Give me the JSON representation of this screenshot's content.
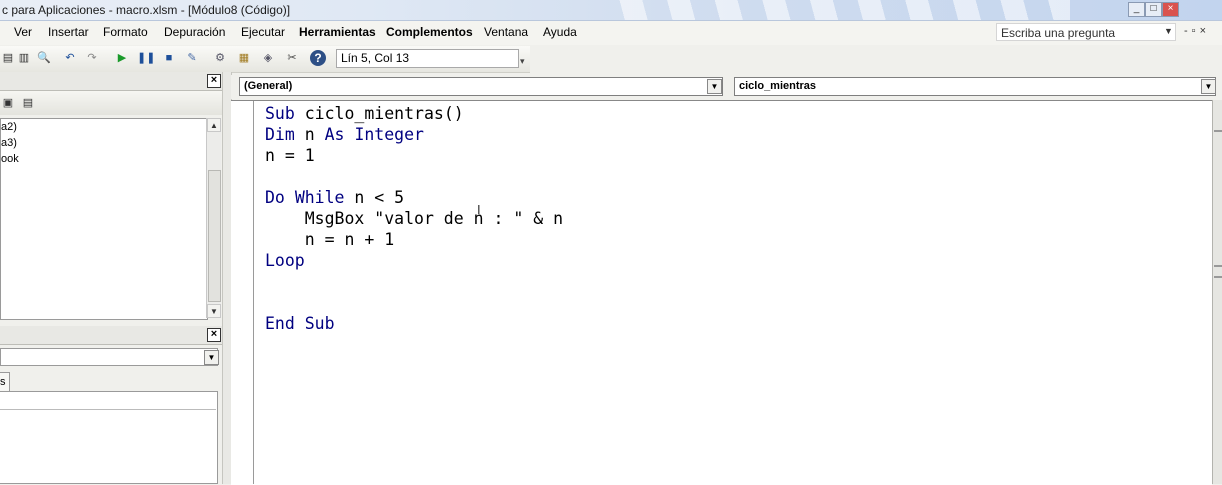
{
  "window": {
    "title": "c para Aplicaciones - macro.xlsm - [Módulo8 (Código)]",
    "controls": [
      "_",
      "□",
      "×"
    ]
  },
  "menu": {
    "items": [
      "Ver",
      "Insertar",
      "Formato",
      "Depuración",
      "Ejecutar",
      "Herramientas",
      "Complementos",
      "Ventana",
      "Ayuda"
    ],
    "ask_placeholder": "Escriba una pregunta"
  },
  "toolbar": {
    "position_text": "Lín 5, Col 13",
    "icons": [
      "excel-icon",
      "insert-module-icon",
      "cut-icon",
      "copy-icon",
      "paste-icon",
      "find-icon",
      "undo-icon",
      "redo-icon",
      "run-icon",
      "break-icon",
      "reset-icon",
      "design-mode-icon",
      "project-explorer-icon",
      "properties-icon",
      "object-browser-icon",
      "toolbox-icon",
      "help-icon"
    ]
  },
  "project_panel": {
    "tree_items": [
      "a2)",
      "a3)",
      "ook"
    ]
  },
  "code_window": {
    "object_combo": "(General)",
    "procedure_combo": "ciclo_mientras",
    "lines": [
      "Sub ciclo_mientras()",
      "Dim n As Integer",
      "n = 1",
      "",
      "Do While n < 5",
      "    MsgBox \"valor de n : \" & n",
      "    n = n + 1",
      "Loop",
      "",
      "",
      "End Sub"
    ]
  },
  "colors": {
    "keyword": "#000080",
    "titlebar": "#cfdcef"
  }
}
